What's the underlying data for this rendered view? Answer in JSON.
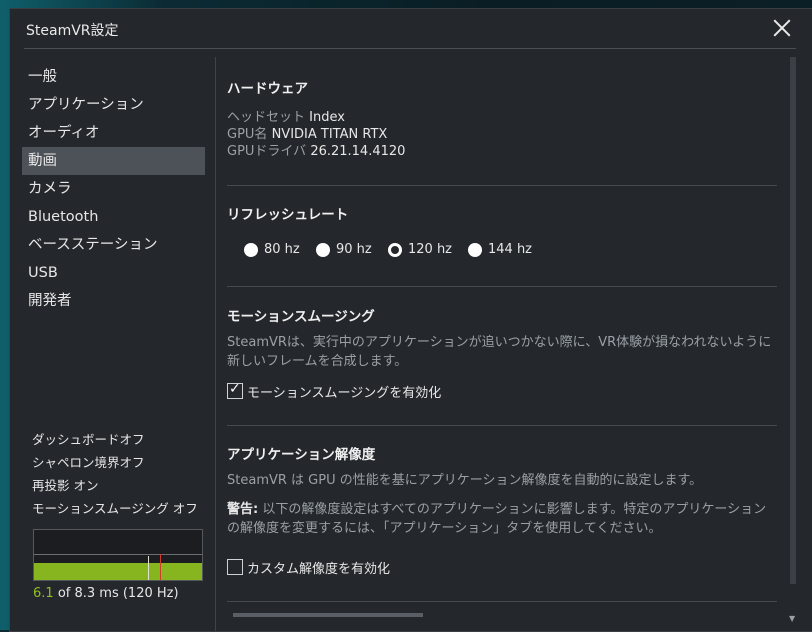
{
  "window": {
    "title": "SteamVR設定"
  },
  "sidebar": {
    "items": [
      {
        "label": "一般"
      },
      {
        "label": "アプリケーション"
      },
      {
        "label": "オーディオ"
      },
      {
        "label": "動画",
        "active": true
      },
      {
        "label": "カメラ"
      },
      {
        "label": "Bluetooth"
      },
      {
        "label": "ベースステーション"
      },
      {
        "label": "USB"
      },
      {
        "label": "開発者"
      }
    ]
  },
  "status": {
    "lines": [
      "ダッシュボードオフ",
      "シャペロン境界オフ",
      "再投影 オン",
      "モーションスムージング オフ"
    ],
    "frame_time": {
      "value": "6.1",
      "rest": " of 8.3 ms (120 Hz)"
    },
    "colors": {
      "graph_fill": "#86b51f",
      "highlight": "#8fbf22",
      "spike": "#d23b2a"
    }
  },
  "hardware": {
    "heading": "ハードウェア",
    "rows": [
      {
        "key": "ヘッドセット",
        "value": "Index"
      },
      {
        "key": "GPU名",
        "value": "NVIDIA TITAN RTX"
      },
      {
        "key": "GPUドライバ",
        "value": "26.21.14.4120"
      }
    ]
  },
  "refresh": {
    "heading": "リフレッシュレート",
    "options": [
      {
        "label": "80 hz",
        "selected": false
      },
      {
        "label": "90 hz",
        "selected": false
      },
      {
        "label": "120 hz",
        "selected": true
      },
      {
        "label": "144 hz",
        "selected": false
      }
    ]
  },
  "motion": {
    "heading": "モーションスムージング",
    "description": "SteamVRは、実行中のアプリケーションが追いつかない際に、VR体験が損なわれないように新しいフレームを合成します。",
    "checkbox_label": "モーションスムージングを有効化",
    "checked": true
  },
  "resolution": {
    "heading": "アプリケーション解像度",
    "description": "SteamVR は GPU の性能を基にアプリケーション解像度を自動的に設定します。",
    "warning_label": "警告:",
    "warning_text": " 以下の解像度設定はすべてのアプリケーションに影響します。特定のアプリケーションの解像度を変更するには、「アプリケーション」タブを使用してください。",
    "checkbox_label": "カスタム解像度を有効化",
    "checked": false
  }
}
